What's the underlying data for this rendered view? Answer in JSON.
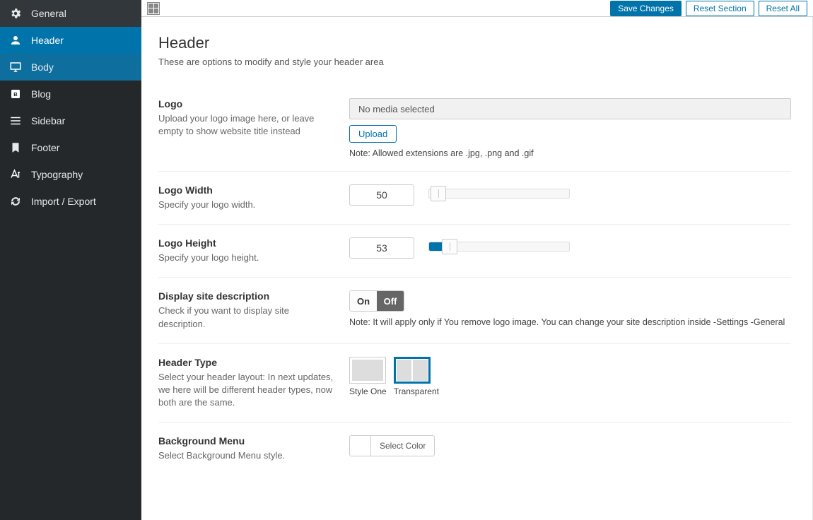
{
  "sidebar": {
    "items": [
      {
        "icon": "gear",
        "label": "General"
      },
      {
        "icon": "person",
        "label": "Header"
      },
      {
        "icon": "monitor",
        "label": "Body"
      },
      {
        "icon": "blog",
        "label": "Blog"
      },
      {
        "icon": "menu",
        "label": "Sidebar"
      },
      {
        "icon": "bookmark",
        "label": "Footer"
      },
      {
        "icon": "typography",
        "label": "Typography"
      },
      {
        "icon": "sync",
        "label": "Import / Export"
      }
    ]
  },
  "topbar": {
    "save": "Save Changes",
    "reset_section": "Reset Section",
    "reset_all": "Reset All"
  },
  "page": {
    "title": "Header",
    "description": "These are options to modify and style your header area"
  },
  "fields": {
    "logo": {
      "title": "Logo",
      "desc": "Upload your logo image here, or leave empty to show website title instead",
      "media_placeholder": "No media selected",
      "upload_label": "Upload",
      "note": "Note: Allowed extensions are .jpg, .png and .gif"
    },
    "logo_width": {
      "title": "Logo Width",
      "desc": "Specify your logo width.",
      "value": "50"
    },
    "logo_height": {
      "title": "Logo Height",
      "desc": "Specify your logo height.",
      "value": "53"
    },
    "site_desc": {
      "title": "Display site description",
      "desc": "Check if you want to display site description.",
      "on": "On",
      "off": "Off",
      "note": "Note: It will apply only if You remove logo image. You can change your site description inside -Settings -General"
    },
    "header_type": {
      "title": "Header Type",
      "desc": "Select your header layout: In next updates, we here will be different header types, now both are the same.",
      "opt1": "Style One",
      "opt2": "Transparent"
    },
    "bg_menu": {
      "title": "Background Menu",
      "desc": "Select Background Menu style.",
      "btn": "Select Color"
    }
  }
}
